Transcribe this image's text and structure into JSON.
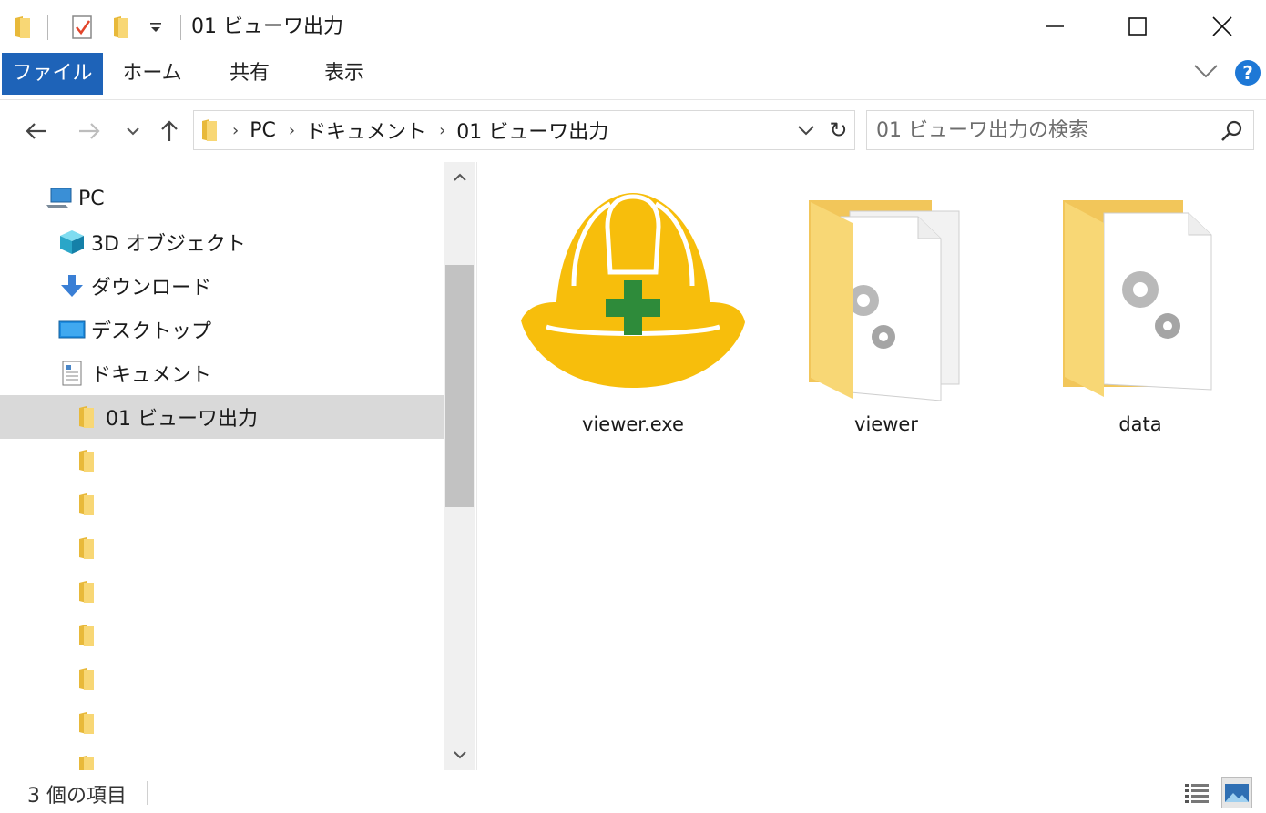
{
  "window": {
    "title": "01 ビューワ出力",
    "minimize_icon": "minimize-icon",
    "maximize_icon": "maximize-icon",
    "close_icon": "close-icon"
  },
  "ribbon": {
    "tabs": [
      {
        "label": "ファイル"
      },
      {
        "label": "ホーム"
      },
      {
        "label": "共有"
      },
      {
        "label": "表示"
      }
    ],
    "help_label": "?"
  },
  "address": {
    "crumbs": [
      "PC",
      "ドキュメント",
      "01 ビューワ出力"
    ],
    "refresh_glyph": "↻"
  },
  "search": {
    "placeholder": "01 ビューワ出力の検索"
  },
  "nav": {
    "items": [
      {
        "label": "PC",
        "icon": "pc-icon"
      },
      {
        "label": "3D オブジェクト",
        "icon": "3d-objects-icon"
      },
      {
        "label": "ダウンロード",
        "icon": "download-icon"
      },
      {
        "label": "デスクトップ",
        "icon": "desktop-icon"
      },
      {
        "label": "ドキュメント",
        "icon": "documents-icon"
      },
      {
        "label": "01 ビューワ出力",
        "icon": "folder-icon",
        "selected": true
      }
    ]
  },
  "files": [
    {
      "name": "viewer.exe",
      "icon": "hardhat-app-icon"
    },
    {
      "name": "viewer",
      "icon": "settings-folder-icon"
    },
    {
      "name": "data",
      "icon": "settings-folder-icon"
    }
  ],
  "status": {
    "count_text": "3 個の項目"
  },
  "colors": {
    "file_tab": "#1e63b8",
    "selected": "#d9d9d9",
    "hardhat": "#f7be0c",
    "cross": "#2e8b3a",
    "folder": "#f8d775"
  }
}
